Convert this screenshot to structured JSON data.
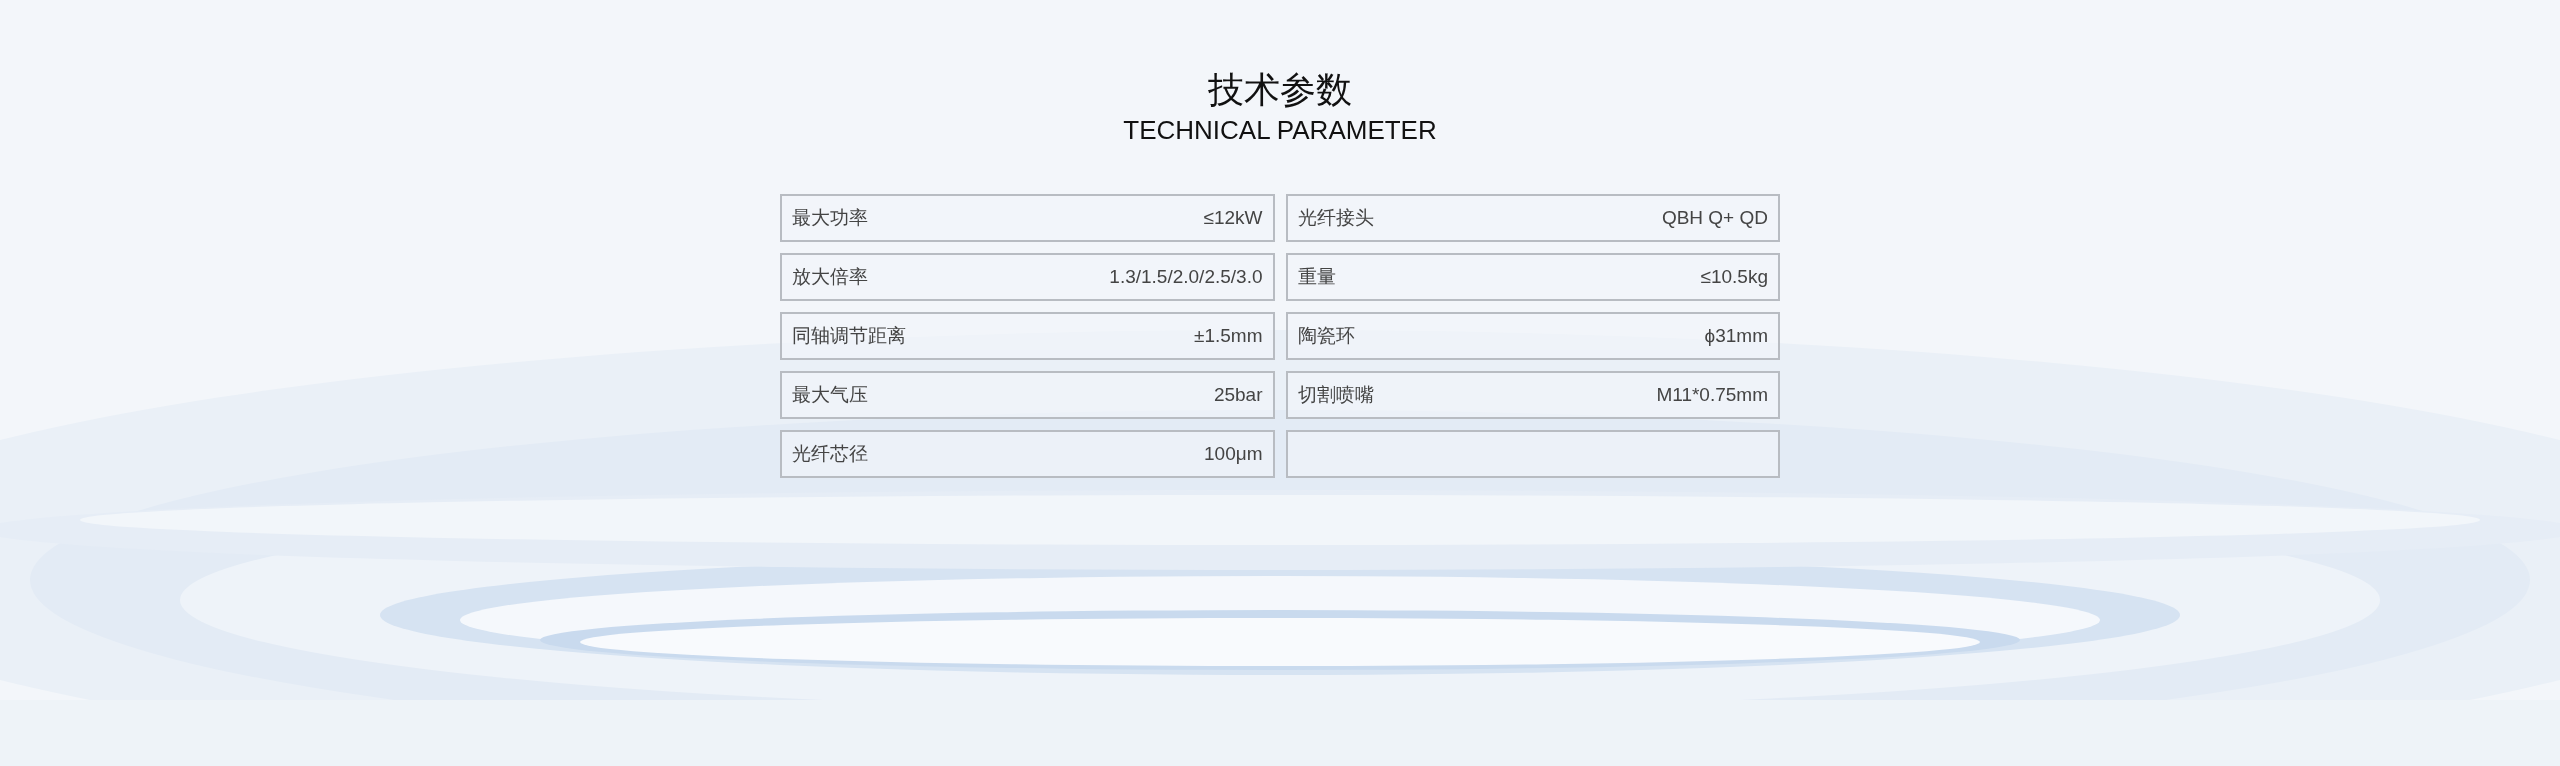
{
  "heading": {
    "title": "技术参数",
    "subtitle": "TECHNICAL PARAMETER"
  },
  "parameters": [
    {
      "label": "最大功率",
      "value": "≤12kW"
    },
    {
      "label": "光纤接头",
      "value": "QBH Q+ QD"
    },
    {
      "label": "放大倍率",
      "value": "1.3/1.5/2.0/2.5/3.0"
    },
    {
      "label": "重量",
      "value": "≤10.5kg"
    },
    {
      "label": "同轴调节距离",
      "value": "±1.5mm"
    },
    {
      "label": "陶瓷环",
      "value": "ϕ31mm"
    },
    {
      "label": "最大气压",
      "value": "25bar"
    },
    {
      "label": "切割喷嘴",
      "value": "M11*0.75mm"
    },
    {
      "label": "光纤芯径",
      "value": "100μm"
    }
  ]
}
